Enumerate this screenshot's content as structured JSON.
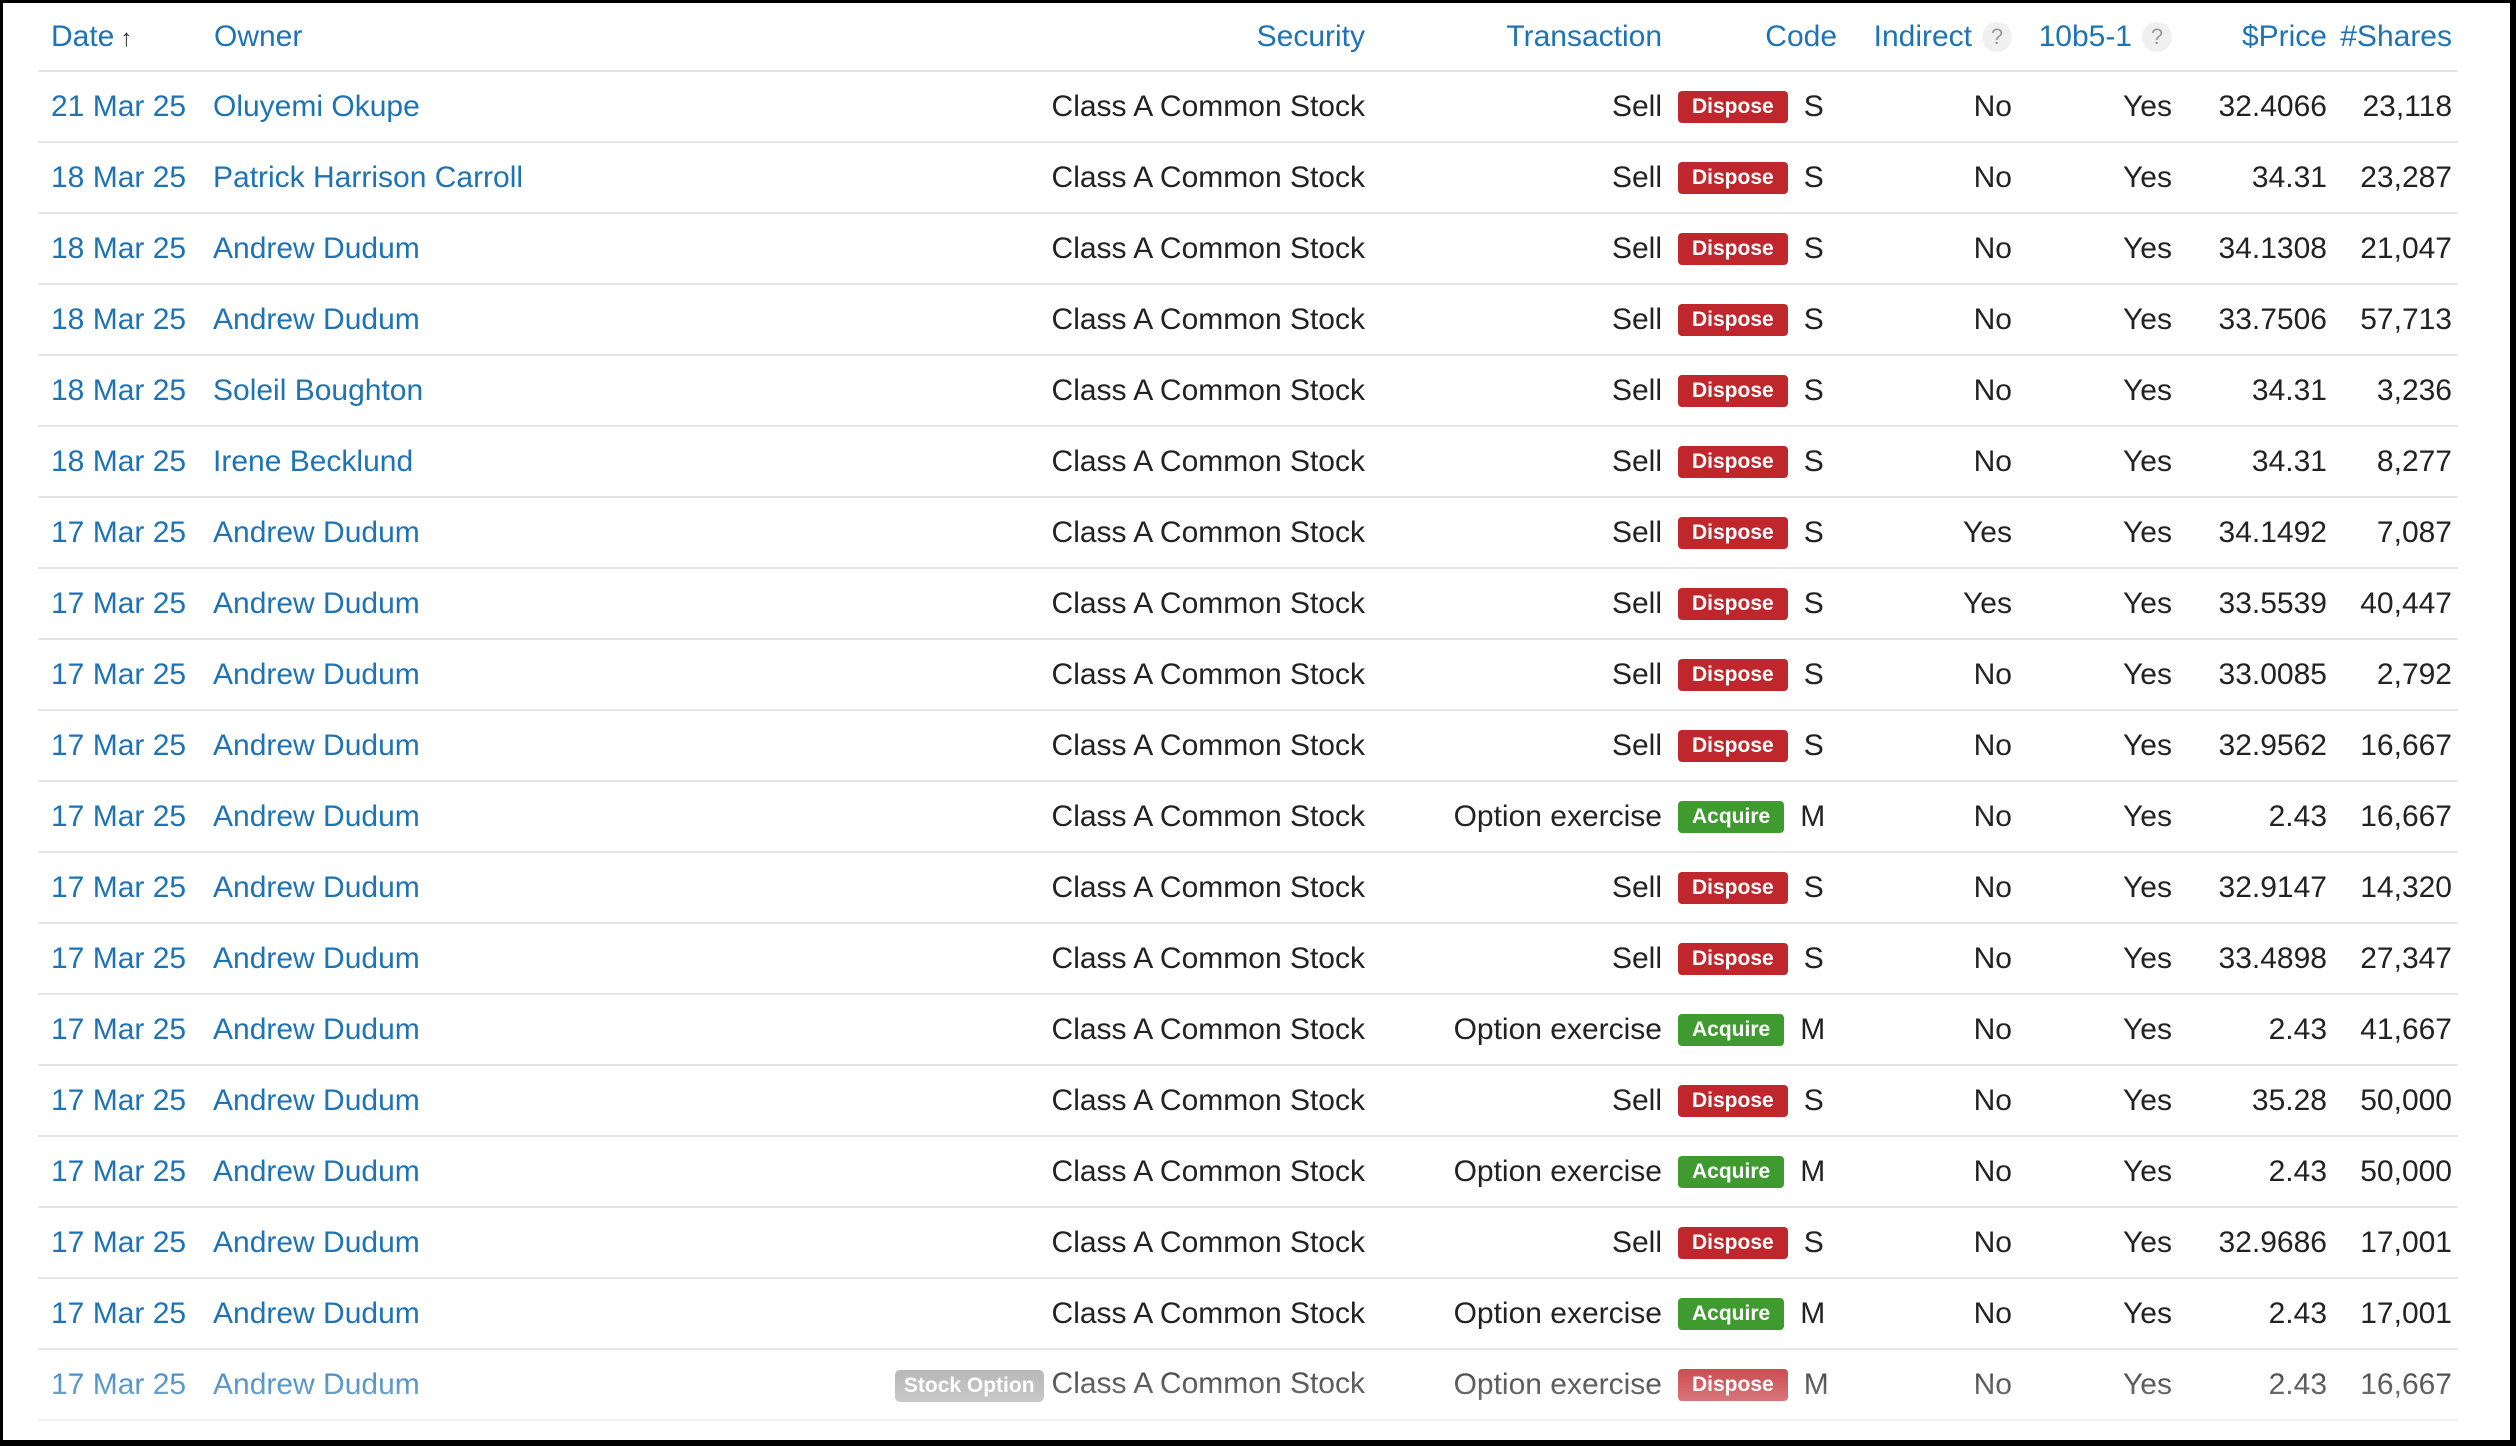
{
  "columns": {
    "date": "Date",
    "owner": "Owner",
    "security": "Security",
    "transaction": "Transaction",
    "code": "Code",
    "indirect": "Indirect",
    "rule": "10b5-1",
    "price": "$Price",
    "shares": "#Shares",
    "help_glyph": "?",
    "sort_glyph": "↑"
  },
  "icons": {
    "sort": "arrow-up-icon",
    "help": "help-icon"
  },
  "colors": {
    "link": "#1e73b5",
    "dispose": "#c0272d",
    "acquire": "#3f9b2f",
    "tag": "#a8a8a8"
  },
  "rows": [
    {
      "date": "21 Mar 25",
      "owner": "Oluyemi Okupe",
      "tag": "",
      "security": "Class A Common Stock",
      "transaction": "Sell",
      "badge": "Dispose",
      "code": "S",
      "indirect": "No",
      "rule": "Yes",
      "price": "32.4066",
      "shares": "23,118"
    },
    {
      "date": "18 Mar 25",
      "owner": "Patrick Harrison Carroll",
      "tag": "",
      "security": "Class A Common Stock",
      "transaction": "Sell",
      "badge": "Dispose",
      "code": "S",
      "indirect": "No",
      "rule": "Yes",
      "price": "34.31",
      "shares": "23,287"
    },
    {
      "date": "18 Mar 25",
      "owner": "Andrew Dudum",
      "tag": "",
      "security": "Class A Common Stock",
      "transaction": "Sell",
      "badge": "Dispose",
      "code": "S",
      "indirect": "No",
      "rule": "Yes",
      "price": "34.1308",
      "shares": "21,047"
    },
    {
      "date": "18 Mar 25",
      "owner": "Andrew Dudum",
      "tag": "",
      "security": "Class A Common Stock",
      "transaction": "Sell",
      "badge": "Dispose",
      "code": "S",
      "indirect": "No",
      "rule": "Yes",
      "price": "33.7506",
      "shares": "57,713"
    },
    {
      "date": "18 Mar 25",
      "owner": "Soleil Boughton",
      "tag": "",
      "security": "Class A Common Stock",
      "transaction": "Sell",
      "badge": "Dispose",
      "code": "S",
      "indirect": "No",
      "rule": "Yes",
      "price": "34.31",
      "shares": "3,236"
    },
    {
      "date": "18 Mar 25",
      "owner": "Irene Becklund",
      "tag": "",
      "security": "Class A Common Stock",
      "transaction": "Sell",
      "badge": "Dispose",
      "code": "S",
      "indirect": "No",
      "rule": "Yes",
      "price": "34.31",
      "shares": "8,277"
    },
    {
      "date": "17 Mar 25",
      "owner": "Andrew Dudum",
      "tag": "",
      "security": "Class A Common Stock",
      "transaction": "Sell",
      "badge": "Dispose",
      "code": "S",
      "indirect": "Yes",
      "rule": "Yes",
      "price": "34.1492",
      "shares": "7,087"
    },
    {
      "date": "17 Mar 25",
      "owner": "Andrew Dudum",
      "tag": "",
      "security": "Class A Common Stock",
      "transaction": "Sell",
      "badge": "Dispose",
      "code": "S",
      "indirect": "Yes",
      "rule": "Yes",
      "price": "33.5539",
      "shares": "40,447"
    },
    {
      "date": "17 Mar 25",
      "owner": "Andrew Dudum",
      "tag": "",
      "security": "Class A Common Stock",
      "transaction": "Sell",
      "badge": "Dispose",
      "code": "S",
      "indirect": "No",
      "rule": "Yes",
      "price": "33.0085",
      "shares": "2,792"
    },
    {
      "date": "17 Mar 25",
      "owner": "Andrew Dudum",
      "tag": "",
      "security": "Class A Common Stock",
      "transaction": "Sell",
      "badge": "Dispose",
      "code": "S",
      "indirect": "No",
      "rule": "Yes",
      "price": "32.9562",
      "shares": "16,667"
    },
    {
      "date": "17 Mar 25",
      "owner": "Andrew Dudum",
      "tag": "",
      "security": "Class A Common Stock",
      "transaction": "Option exercise",
      "badge": "Acquire",
      "code": "M",
      "indirect": "No",
      "rule": "Yes",
      "price": "2.43",
      "shares": "16,667"
    },
    {
      "date": "17 Mar 25",
      "owner": "Andrew Dudum",
      "tag": "",
      "security": "Class A Common Stock",
      "transaction": "Sell",
      "badge": "Dispose",
      "code": "S",
      "indirect": "No",
      "rule": "Yes",
      "price": "32.9147",
      "shares": "14,320"
    },
    {
      "date": "17 Mar 25",
      "owner": "Andrew Dudum",
      "tag": "",
      "security": "Class A Common Stock",
      "transaction": "Sell",
      "badge": "Dispose",
      "code": "S",
      "indirect": "No",
      "rule": "Yes",
      "price": "33.4898",
      "shares": "27,347"
    },
    {
      "date": "17 Mar 25",
      "owner": "Andrew Dudum",
      "tag": "",
      "security": "Class A Common Stock",
      "transaction": "Option exercise",
      "badge": "Acquire",
      "code": "M",
      "indirect": "No",
      "rule": "Yes",
      "price": "2.43",
      "shares": "41,667"
    },
    {
      "date": "17 Mar 25",
      "owner": "Andrew Dudum",
      "tag": "",
      "security": "Class A Common Stock",
      "transaction": "Sell",
      "badge": "Dispose",
      "code": "S",
      "indirect": "No",
      "rule": "Yes",
      "price": "35.28",
      "shares": "50,000"
    },
    {
      "date": "17 Mar 25",
      "owner": "Andrew Dudum",
      "tag": "",
      "security": "Class A Common Stock",
      "transaction": "Option exercise",
      "badge": "Acquire",
      "code": "M",
      "indirect": "No",
      "rule": "Yes",
      "price": "2.43",
      "shares": "50,000"
    },
    {
      "date": "17 Mar 25",
      "owner": "Andrew Dudum",
      "tag": "",
      "security": "Class A Common Stock",
      "transaction": "Sell",
      "badge": "Dispose",
      "code": "S",
      "indirect": "No",
      "rule": "Yes",
      "price": "32.9686",
      "shares": "17,001"
    },
    {
      "date": "17 Mar 25",
      "owner": "Andrew Dudum",
      "tag": "",
      "security": "Class A Common Stock",
      "transaction": "Option exercise",
      "badge": "Acquire",
      "code": "M",
      "indirect": "No",
      "rule": "Yes",
      "price": "2.43",
      "shares": "17,001"
    },
    {
      "date": "17 Mar 25",
      "owner": "Andrew Dudum",
      "tag": "Stock Option",
      "security": "Class A Common Stock",
      "transaction": "Option exercise",
      "badge": "Dispose",
      "code": "M",
      "indirect": "No",
      "rule": "Yes",
      "price": "2.43",
      "shares": "16,667"
    }
  ]
}
